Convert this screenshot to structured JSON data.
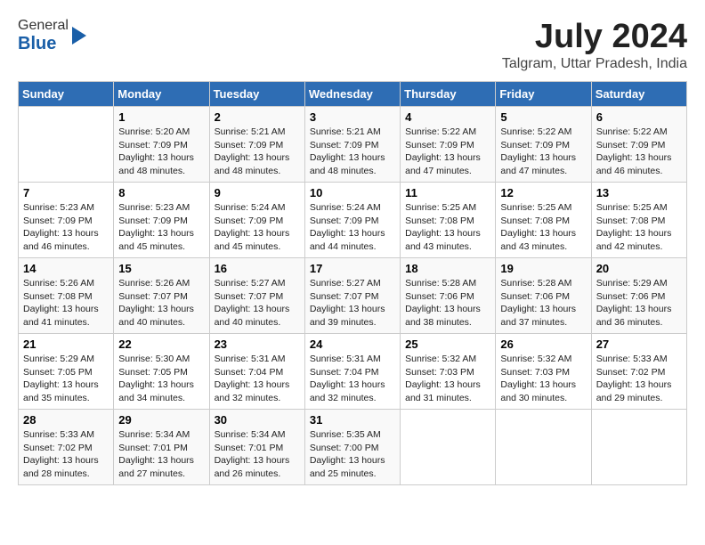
{
  "header": {
    "logo_general": "General",
    "logo_blue": "Blue",
    "month": "July 2024",
    "location": "Talgram, Uttar Pradesh, India"
  },
  "days_of_week": [
    "Sunday",
    "Monday",
    "Tuesday",
    "Wednesday",
    "Thursday",
    "Friday",
    "Saturday"
  ],
  "weeks": [
    [
      {
        "day": "",
        "info": ""
      },
      {
        "day": "1",
        "info": "Sunrise: 5:20 AM\nSunset: 7:09 PM\nDaylight: 13 hours\nand 48 minutes."
      },
      {
        "day": "2",
        "info": "Sunrise: 5:21 AM\nSunset: 7:09 PM\nDaylight: 13 hours\nand 48 minutes."
      },
      {
        "day": "3",
        "info": "Sunrise: 5:21 AM\nSunset: 7:09 PM\nDaylight: 13 hours\nand 48 minutes."
      },
      {
        "day": "4",
        "info": "Sunrise: 5:22 AM\nSunset: 7:09 PM\nDaylight: 13 hours\nand 47 minutes."
      },
      {
        "day": "5",
        "info": "Sunrise: 5:22 AM\nSunset: 7:09 PM\nDaylight: 13 hours\nand 47 minutes."
      },
      {
        "day": "6",
        "info": "Sunrise: 5:22 AM\nSunset: 7:09 PM\nDaylight: 13 hours\nand 46 minutes."
      }
    ],
    [
      {
        "day": "7",
        "info": "Sunrise: 5:23 AM\nSunset: 7:09 PM\nDaylight: 13 hours\nand 46 minutes."
      },
      {
        "day": "8",
        "info": "Sunrise: 5:23 AM\nSunset: 7:09 PM\nDaylight: 13 hours\nand 45 minutes."
      },
      {
        "day": "9",
        "info": "Sunrise: 5:24 AM\nSunset: 7:09 PM\nDaylight: 13 hours\nand 45 minutes."
      },
      {
        "day": "10",
        "info": "Sunrise: 5:24 AM\nSunset: 7:09 PM\nDaylight: 13 hours\nand 44 minutes."
      },
      {
        "day": "11",
        "info": "Sunrise: 5:25 AM\nSunset: 7:08 PM\nDaylight: 13 hours\nand 43 minutes."
      },
      {
        "day": "12",
        "info": "Sunrise: 5:25 AM\nSunset: 7:08 PM\nDaylight: 13 hours\nand 43 minutes."
      },
      {
        "day": "13",
        "info": "Sunrise: 5:25 AM\nSunset: 7:08 PM\nDaylight: 13 hours\nand 42 minutes."
      }
    ],
    [
      {
        "day": "14",
        "info": "Sunrise: 5:26 AM\nSunset: 7:08 PM\nDaylight: 13 hours\nand 41 minutes."
      },
      {
        "day": "15",
        "info": "Sunrise: 5:26 AM\nSunset: 7:07 PM\nDaylight: 13 hours\nand 40 minutes."
      },
      {
        "day": "16",
        "info": "Sunrise: 5:27 AM\nSunset: 7:07 PM\nDaylight: 13 hours\nand 40 minutes."
      },
      {
        "day": "17",
        "info": "Sunrise: 5:27 AM\nSunset: 7:07 PM\nDaylight: 13 hours\nand 39 minutes."
      },
      {
        "day": "18",
        "info": "Sunrise: 5:28 AM\nSunset: 7:06 PM\nDaylight: 13 hours\nand 38 minutes."
      },
      {
        "day": "19",
        "info": "Sunrise: 5:28 AM\nSunset: 7:06 PM\nDaylight: 13 hours\nand 37 minutes."
      },
      {
        "day": "20",
        "info": "Sunrise: 5:29 AM\nSunset: 7:06 PM\nDaylight: 13 hours\nand 36 minutes."
      }
    ],
    [
      {
        "day": "21",
        "info": "Sunrise: 5:29 AM\nSunset: 7:05 PM\nDaylight: 13 hours\nand 35 minutes."
      },
      {
        "day": "22",
        "info": "Sunrise: 5:30 AM\nSunset: 7:05 PM\nDaylight: 13 hours\nand 34 minutes."
      },
      {
        "day": "23",
        "info": "Sunrise: 5:31 AM\nSunset: 7:04 PM\nDaylight: 13 hours\nand 32 minutes."
      },
      {
        "day": "24",
        "info": "Sunrise: 5:31 AM\nSunset: 7:04 PM\nDaylight: 13 hours\nand 32 minutes."
      },
      {
        "day": "25",
        "info": "Sunrise: 5:32 AM\nSunset: 7:03 PM\nDaylight: 13 hours\nand 31 minutes."
      },
      {
        "day": "26",
        "info": "Sunrise: 5:32 AM\nSunset: 7:03 PM\nDaylight: 13 hours\nand 30 minutes."
      },
      {
        "day": "27",
        "info": "Sunrise: 5:33 AM\nSunset: 7:02 PM\nDaylight: 13 hours\nand 29 minutes."
      }
    ],
    [
      {
        "day": "28",
        "info": "Sunrise: 5:33 AM\nSunset: 7:02 PM\nDaylight: 13 hours\nand 28 minutes."
      },
      {
        "day": "29",
        "info": "Sunrise: 5:34 AM\nSunset: 7:01 PM\nDaylight: 13 hours\nand 27 minutes."
      },
      {
        "day": "30",
        "info": "Sunrise: 5:34 AM\nSunset: 7:01 PM\nDaylight: 13 hours\nand 26 minutes."
      },
      {
        "day": "31",
        "info": "Sunrise: 5:35 AM\nSunset: 7:00 PM\nDaylight: 13 hours\nand 25 minutes."
      },
      {
        "day": "",
        "info": ""
      },
      {
        "day": "",
        "info": ""
      },
      {
        "day": "",
        "info": ""
      }
    ]
  ]
}
